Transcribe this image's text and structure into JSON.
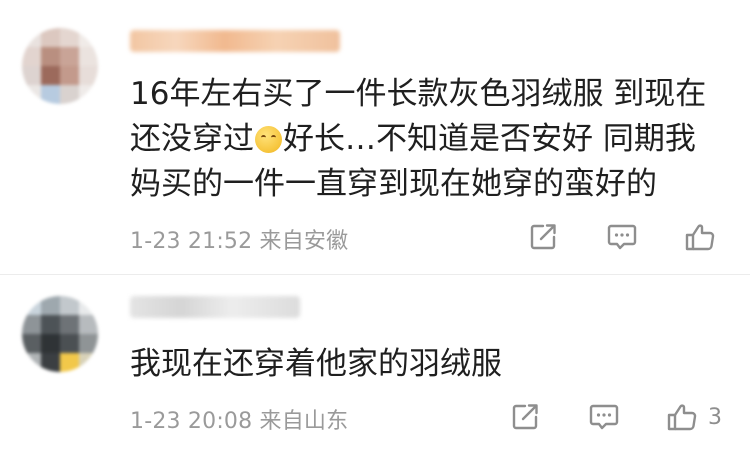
{
  "comments": [
    {
      "text_before_emoji": "16年左右买了一件长款灰色羽绒服 到现在还没穿过",
      "emoji_name": "sad-face-emoji",
      "text_after_emoji": "好长…不知道是否安好 同期我妈买的一件一直穿到现在她穿的蛮好的",
      "time": "1-23 21:52",
      "source": "来自安徽",
      "like_count": ""
    },
    {
      "text": "我现在还穿着他家的羽绒服",
      "time": "1-23 20:08",
      "source": "来自山东",
      "like_count": "3"
    }
  ],
  "icons": {
    "repost": "share-edit-icon",
    "reply": "comment-bubble-icon",
    "like": "thumbs-up-icon"
  },
  "colors": {
    "text": "#1f1f1f",
    "meta": "#9a9a9a",
    "icon": "#8e8e8e",
    "divider": "#ececec"
  }
}
